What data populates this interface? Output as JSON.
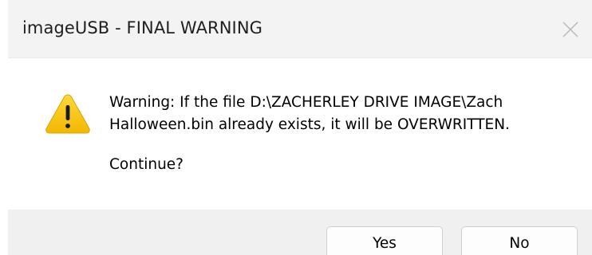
{
  "window": {
    "title": "imageUSB - FINAL WARNING"
  },
  "message": {
    "line1": "Warning: If the file D:\\ZACHERLEY DRIVE IMAGE\\Zach",
    "line2": "Halloween.bin already exists, it will be OVERWRITTEN.",
    "line3": "Continue?"
  },
  "buttons": {
    "yes_label": "Yes",
    "no_label": "No"
  },
  "icons": {
    "warning": "warning-triangle-icon",
    "close": "close-icon"
  },
  "colors": {
    "warning_fill": "#f5c400",
    "titlebar_bg": "#f3f3f3",
    "footer_bg": "#f0f0f0"
  }
}
